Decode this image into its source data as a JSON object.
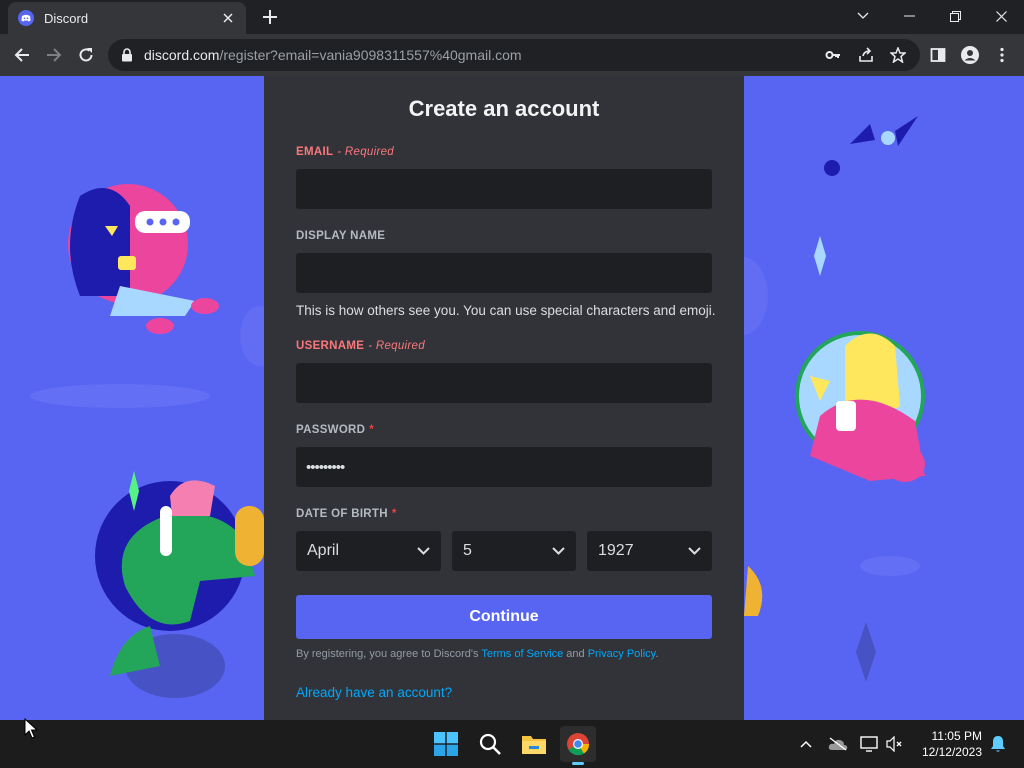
{
  "browser": {
    "tab_title": "Discord",
    "url_host": "discord.com",
    "url_path": "/register?email=vania9098311557%40gmail.com"
  },
  "form": {
    "title": "Create an account",
    "email_label": "EMAIL",
    "required_text": "- Required",
    "display_name_label": "DISPLAY NAME",
    "display_name_hint": "This is how others see you. You can use special characters and emoji.",
    "username_label": "USERNAME",
    "password_label": "PASSWORD",
    "password_value": "•••••••••",
    "required_star": "*",
    "dob_label": "DATE OF BIRTH",
    "dob_month": "April",
    "dob_day": "5",
    "dob_year": "1927",
    "continue_label": "Continue",
    "terms_prefix": "By registering, you agree to Discord's ",
    "terms_link": "Terms of Service",
    "terms_and": " and ",
    "privacy_link": "Privacy Policy",
    "terms_suffix": ".",
    "login_link": "Already have an account?"
  },
  "taskbar": {
    "time": "11:05 PM",
    "date": "12/12/2023"
  },
  "colors": {
    "brand": "#5865f2",
    "card": "#313338",
    "input": "#1e1f22",
    "error": "#fa777c",
    "link": "#00a8fc"
  },
  "icons": [
    "discord-icon",
    "close-icon",
    "plus-icon",
    "chevron-down-icon",
    "minimize-icon",
    "restore-icon",
    "back-icon",
    "forward-icon",
    "reload-icon",
    "lock-icon",
    "key-icon",
    "share-icon",
    "star-icon",
    "side-panel-icon",
    "profile-icon",
    "kebab-menu-icon",
    "windows-start-icon",
    "search-icon",
    "file-explorer-icon",
    "chrome-icon",
    "chevron-up-icon",
    "onedrive-icon",
    "network-icon",
    "volume-muted-icon",
    "bell-icon",
    "mouse-cursor-icon"
  ]
}
